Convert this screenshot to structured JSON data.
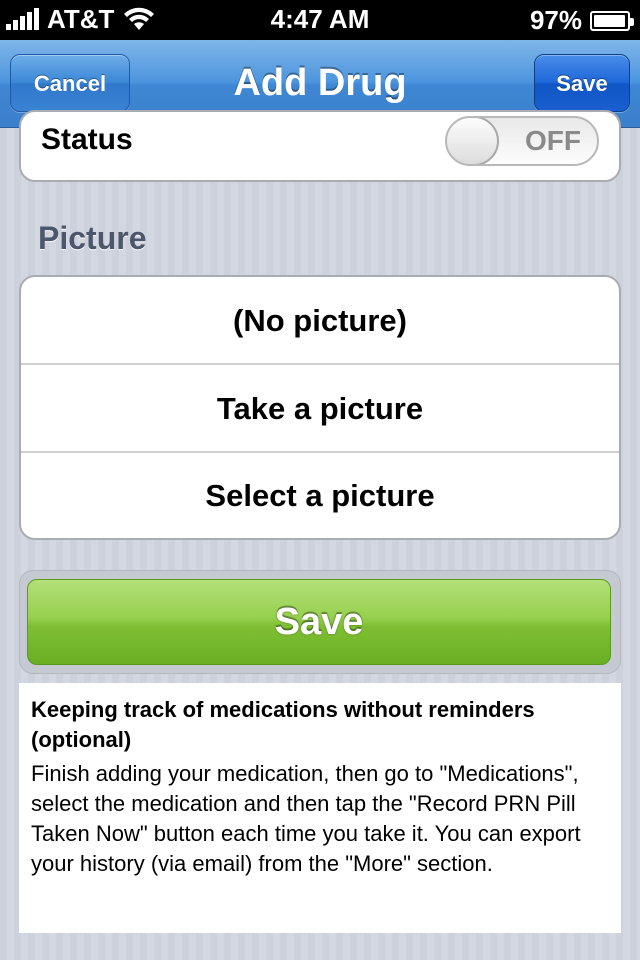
{
  "status_bar": {
    "carrier": "AT&T",
    "time": "4:47 AM",
    "battery": "97%"
  },
  "nav": {
    "title": "Add Drug",
    "cancel_label": "Cancel",
    "save_label": "Save"
  },
  "status_row": {
    "label": "Status",
    "toggle_state": "OFF"
  },
  "picture_section": {
    "header": "Picture",
    "options": [
      "(No picture)",
      "Take a picture",
      "Select a picture"
    ]
  },
  "save_button": {
    "label": "Save",
    "color": "#7fbf34"
  },
  "info": {
    "title": "Keeping track of medications without reminders (optional)",
    "body": "Finish adding your medication, then go to \"Medications\", select the medication and then tap the \"Record PRN Pill Taken Now\" button each time you take it. You can export your history (via email) from the \"More\" section."
  },
  "icons": [
    "signal-icon",
    "wifi-icon",
    "battery-icon"
  ],
  "colors": {
    "nav_blue": "#3f87d4",
    "save_nav_blue": "#1c66d8",
    "section_header": "#4c566c"
  }
}
